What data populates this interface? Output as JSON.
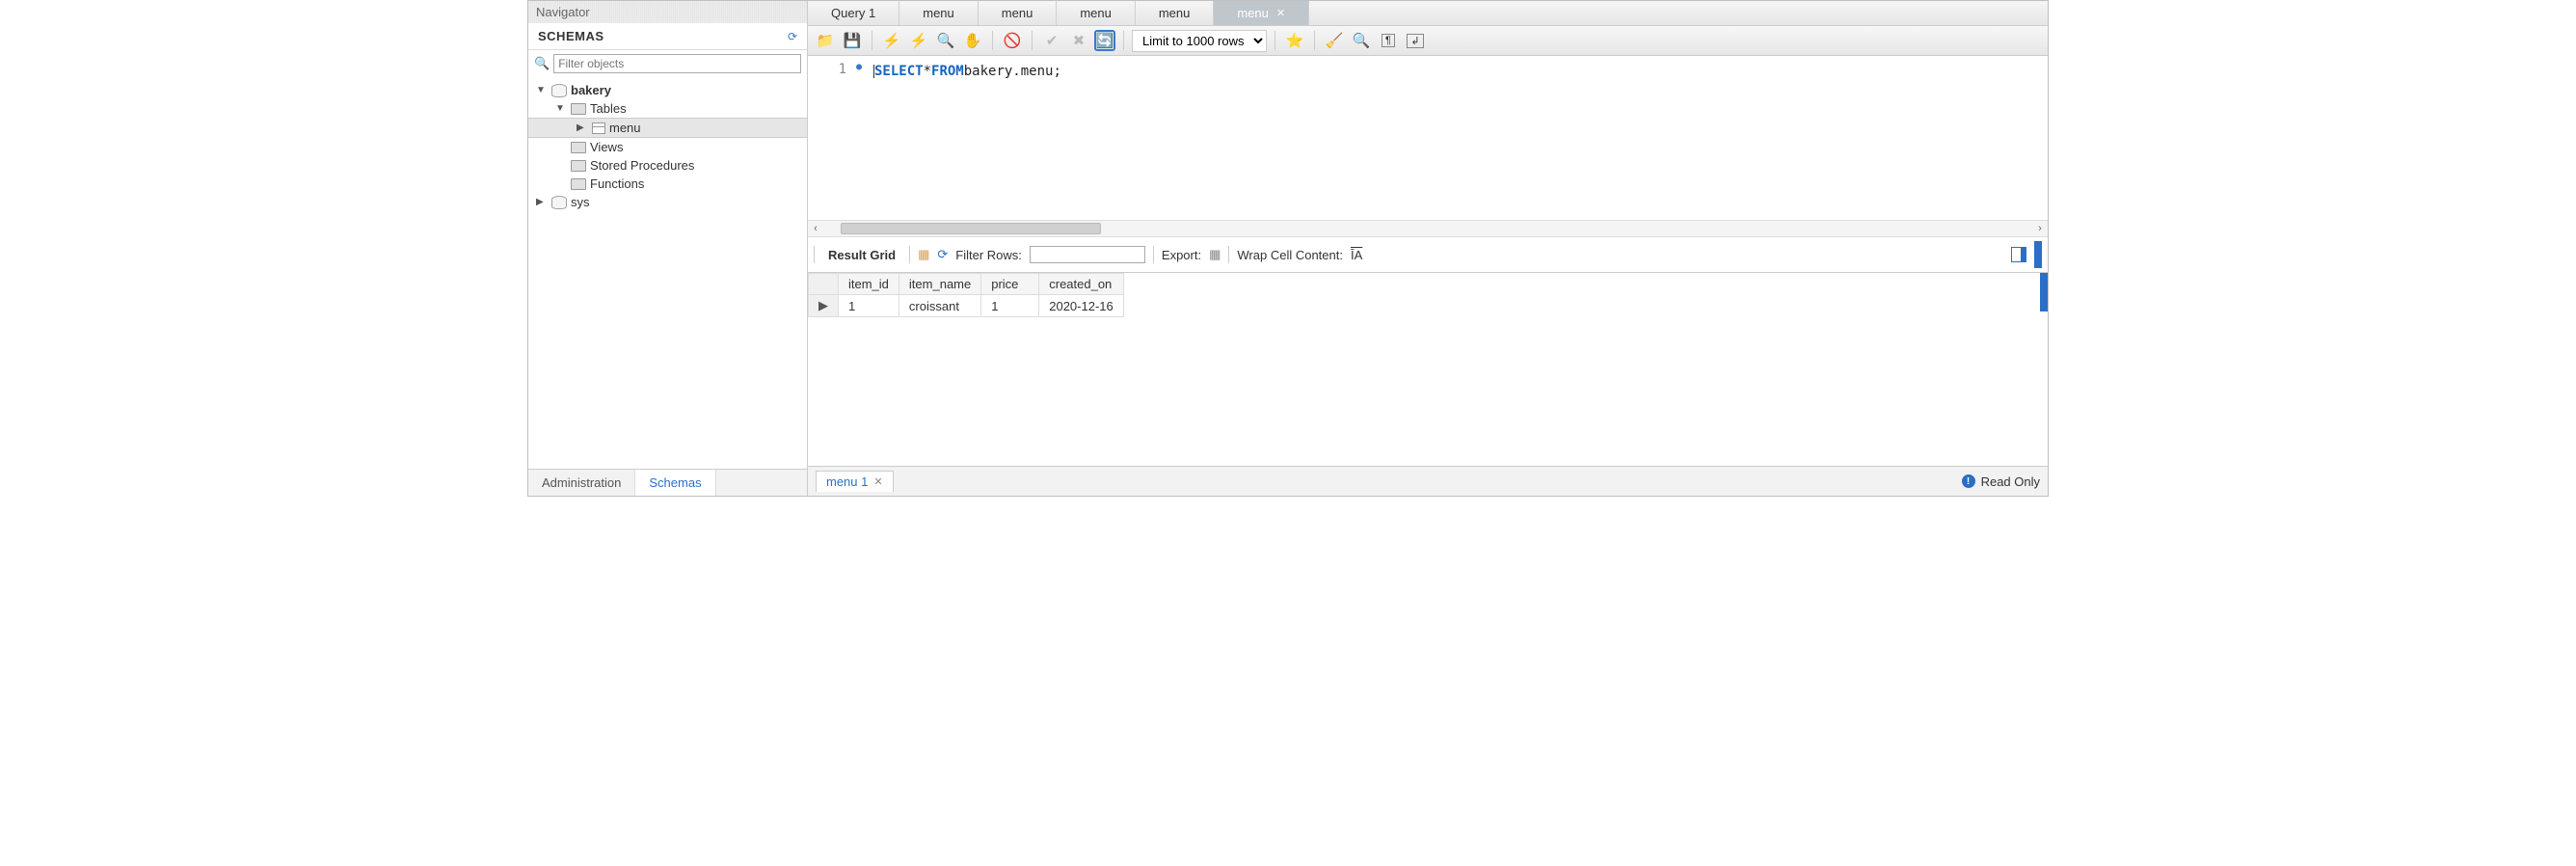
{
  "navigator": {
    "title": "Navigator",
    "schemas_label": "SCHEMAS",
    "filter_placeholder": "Filter objects",
    "tree": {
      "db_name": "bakery",
      "tables_label": "Tables",
      "table_items": [
        "menu"
      ],
      "views_label": "Views",
      "sp_label": "Stored Procedures",
      "functions_label": "Functions",
      "sys_db": "sys"
    },
    "bottom_tabs": {
      "admin": "Administration",
      "schemas": "Schemas"
    }
  },
  "query_tabs": [
    "Query 1",
    "menu",
    "menu",
    "menu",
    "menu",
    "menu"
  ],
  "active_query_tab_index": 5,
  "toolbar": {
    "limit_label": "Limit to 1000 rows"
  },
  "editor": {
    "line_number": "1",
    "sql_kw1": "SELECT",
    "sql_mid": " * ",
    "sql_kw2": "FROM",
    "sql_tail": " bakery.menu;"
  },
  "result_toolbar": {
    "grid_label": "Result Grid",
    "filter_label": "Filter Rows:",
    "export_label": "Export:",
    "wrap_label": "Wrap Cell Content:",
    "wrap_icon_text": "ĪA"
  },
  "result": {
    "columns": [
      "item_id",
      "item_name",
      "price",
      "created_on"
    ],
    "rows": [
      {
        "item_id": "1",
        "item_name": "croissant",
        "price": "1",
        "created_on": "2020-12-16"
      }
    ]
  },
  "footer": {
    "tab_label": "menu 1",
    "readonly_label": "Read Only"
  }
}
